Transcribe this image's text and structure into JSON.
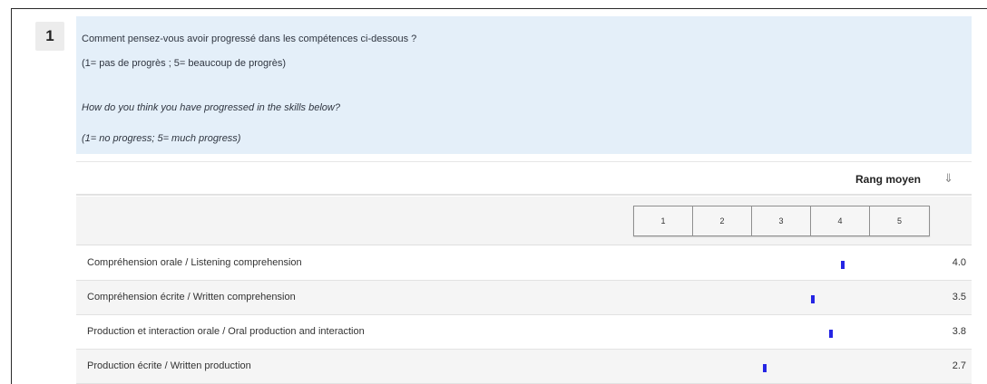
{
  "question": {
    "number": "1",
    "lines": [
      "Comment pensez-vous avoir progressé dans les compétences ci-dessous ?",
      "(1= pas de progrès ; 5= beaucoup de progrès)",
      "How do you think you have progressed in the skills below?",
      "(1= no progress; 5= much progress)"
    ]
  },
  "table": {
    "header": {
      "rang_label": "Rang moyen",
      "sort_icon": "sort-down-arrow-icon"
    },
    "scale": [
      "1",
      "2",
      "3",
      "4",
      "5"
    ],
    "rows": [
      {
        "label": "Compréhension orale / Listening comprehension",
        "value": "4.0",
        "mean": 4.0
      },
      {
        "label": "Compréhension écrite / Written comprehension",
        "value": "3.5",
        "mean": 3.5
      },
      {
        "label": "Production et interaction orale / Oral production and interaction",
        "value": "3.8",
        "mean": 3.8
      },
      {
        "label": "Production écrite / Written production",
        "value": "2.7",
        "mean": 2.7
      }
    ]
  },
  "colors": {
    "marker": "#2525e4",
    "question_bg": "#e4eff9"
  }
}
